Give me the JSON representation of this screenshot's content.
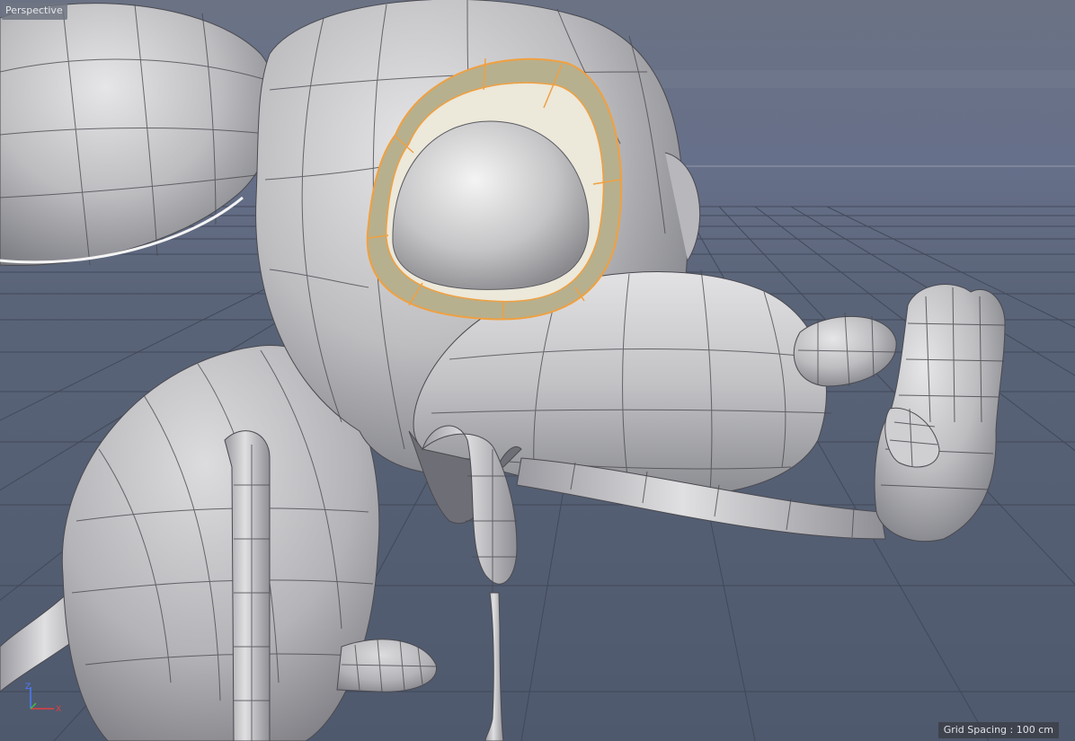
{
  "viewport": {
    "view_name": "Perspective",
    "grid_spacing_text": "Grid Spacing : 100 cm",
    "axes": [
      "Z",
      "X"
    ]
  },
  "colors": {
    "background_top": "#6a7284",
    "background_bottom": "#4f596d",
    "grid_line": "#3f4757",
    "mesh_fill": "#c9c9cb",
    "mesh_wire": "#4a4a50",
    "selection": "#f0a040",
    "axis_z": "#4a7bff",
    "axis_x": "#e04040",
    "axis_y": "#40c040"
  },
  "model": {
    "name": "mouse-character",
    "selected_part": "eye-socket-loop"
  }
}
